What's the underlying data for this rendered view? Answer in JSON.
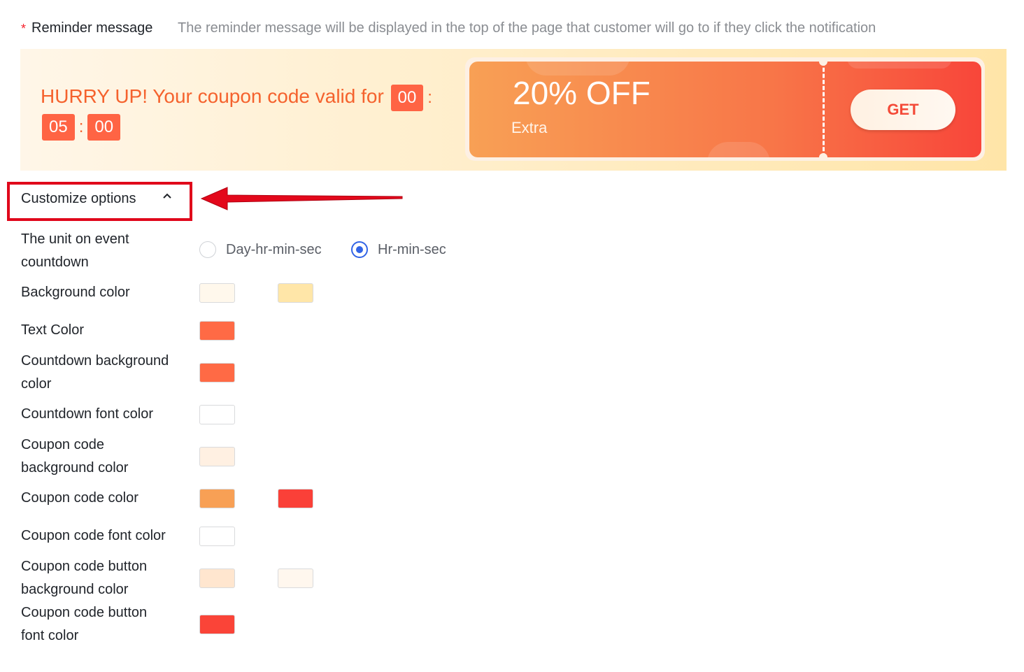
{
  "reminder": {
    "required_mark": "*",
    "label": "Reminder message",
    "help": "The reminder message will be displayed in the top of the page that customer will go to if they click the notification"
  },
  "preview": {
    "message": "HURRY UP! Your coupon code valid for",
    "countdown": {
      "hours": "00",
      "minutes": "05",
      "seconds": "00",
      "separator": ":"
    },
    "coupon": {
      "discount": "20% OFF",
      "subtitle": "Extra",
      "button": "GET"
    }
  },
  "customize": {
    "label": "Customize options",
    "chevron_icon": "chevron-up-icon"
  },
  "options": {
    "unit": {
      "label": "The unit on event countdown",
      "choices": [
        "Day-hr-min-sec",
        "Hr-min-sec"
      ],
      "selected": "Hr-min-sec"
    },
    "background_color": {
      "label": "Background color",
      "colors": [
        "#fff8ec",
        "#ffe6a8"
      ]
    },
    "text_color": {
      "label": "Text Color",
      "colors": [
        "#ff6a45"
      ]
    },
    "countdown_background_color": {
      "label": "Countdown background color",
      "colors": [
        "#ff6a45"
      ]
    },
    "countdown_font_color": {
      "label": "Countdown font color",
      "colors": [
        "#ffffff"
      ]
    },
    "coupon_code_background_color": {
      "label": "Coupon code background color",
      "colors": [
        "#fff0e2"
      ]
    },
    "coupon_code_color": {
      "label": "Coupon code color",
      "colors": [
        "#f8a055",
        "#fa4038"
      ]
    },
    "coupon_code_font_color": {
      "label": "Coupon code font color",
      "colors": [
        "#ffffff"
      ]
    },
    "coupon_code_button_background_color": {
      "label": "Coupon code button background color",
      "colors": [
        "#ffe6cf",
        "#fff7ee"
      ]
    },
    "coupon_code_button_font_color": {
      "label": "Coupon code button font color",
      "colors": [
        "#fa4438"
      ]
    }
  }
}
